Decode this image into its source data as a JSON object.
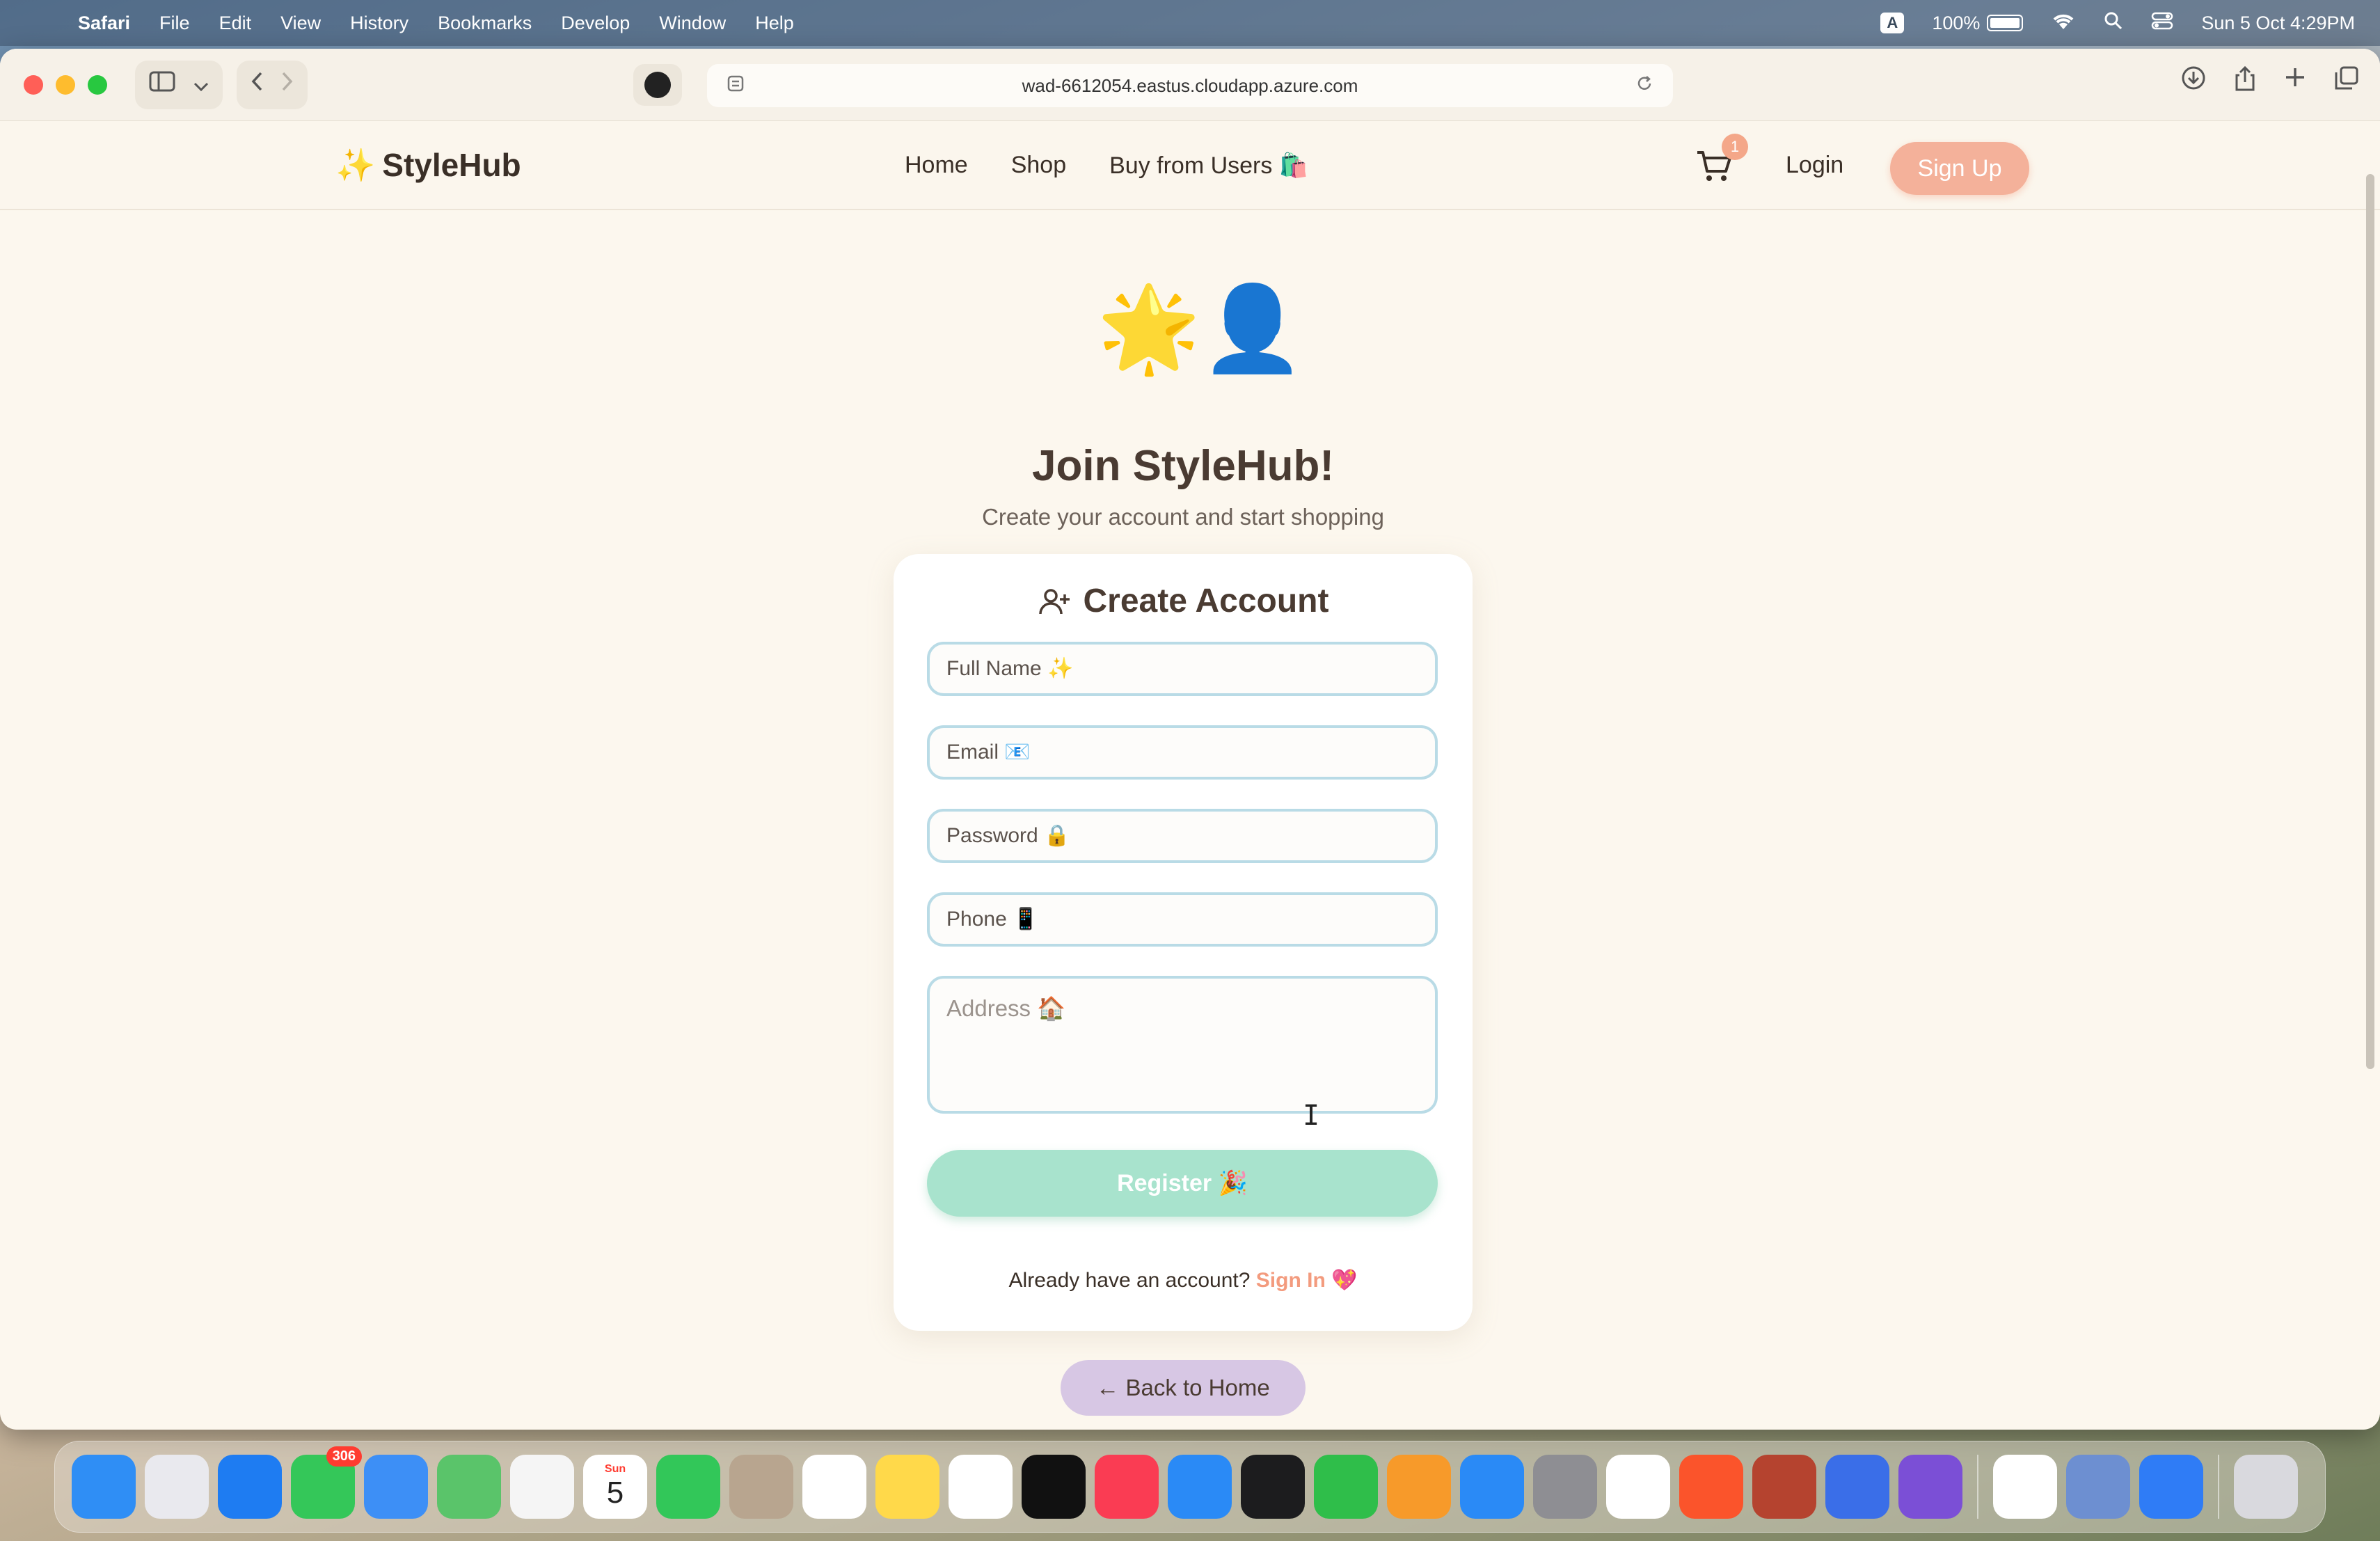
{
  "menubar": {
    "apple": "",
    "items": [
      "Safari",
      "File",
      "Edit",
      "View",
      "History",
      "Bookmarks",
      "Develop",
      "Window",
      "Help"
    ],
    "input_source": "A",
    "battery": "100%",
    "datetime": "Sun 5 Oct  4:29PM"
  },
  "browser": {
    "url": "wad-6612054.eastus.cloudapp.azure.com"
  },
  "site": {
    "logo_sparkle": "✨",
    "logo_text": "StyleHub",
    "nav": [
      "Home",
      "Shop",
      "Buy from Users 🛍️"
    ],
    "cart_count": "1",
    "login": "Login",
    "signup": "Sign Up"
  },
  "hero": {
    "emoji": "🌟👤",
    "title": "Join StyleHub!",
    "subtitle": "Create your account and start shopping"
  },
  "form": {
    "title": "Create Account",
    "full_name_placeholder": "Full Name ✨",
    "email_placeholder": "Email 📧",
    "password_placeholder": "Password 🔒",
    "phone_placeholder": "Phone 📱",
    "address_placeholder": "Address 🏠",
    "register_label": "Register 🎉",
    "signin_prompt": "Already have an account?",
    "signin_link": "Sign In 💖"
  },
  "back_home": "← Back to Home",
  "dock": {
    "messages_badge": "306",
    "calendar_day": "5",
    "calendar_month": "Sun",
    "apps": [
      {
        "name": "finder-icon",
        "color": "#2f8ef5"
      },
      {
        "name": "launchpad-icon",
        "color": "#e9e9ee"
      },
      {
        "name": "safari-icon",
        "color": "#1e7cf2"
      },
      {
        "name": "messages-icon",
        "color": "#34c759"
      },
      {
        "name": "mail-icon",
        "color": "#3d8ff6"
      },
      {
        "name": "maps-icon",
        "color": "#5ac46a"
      },
      {
        "name": "photos-icon",
        "color": "#f5f5f5"
      },
      {
        "name": "calendar-icon",
        "color": "#ffffff"
      },
      {
        "name": "facetime-icon",
        "color": "#32c759"
      },
      {
        "name": "contacts-icon",
        "color": "#b8a58f"
      },
      {
        "name": "reminders-icon",
        "color": "#ffffff"
      },
      {
        "name": "notes-icon",
        "color": "#ffd94a"
      },
      {
        "name": "freeform-icon",
        "color": "#ffffff"
      },
      {
        "name": "tv-icon",
        "color": "#111111"
      },
      {
        "name": "music-icon",
        "color": "#fa3c53"
      },
      {
        "name": "keynote-icon",
        "color": "#2a8af6"
      },
      {
        "name": "terminal-icon",
        "color": "#1c1c1e"
      },
      {
        "name": "numbers-icon",
        "color": "#2fbe4a"
      },
      {
        "name": "pages-icon",
        "color": "#f79a2a"
      },
      {
        "name": "app-store-icon",
        "color": "#2a8af6"
      },
      {
        "name": "system-settings-icon",
        "color": "#8e8e93"
      },
      {
        "name": "chrome-icon",
        "color": "#ffffff"
      },
      {
        "name": "brave-icon",
        "color": "#fb542b"
      },
      {
        "name": "dictionary-icon",
        "color": "#b5432f"
      },
      {
        "name": "simulator-icon",
        "color": "#3a6ee8"
      },
      {
        "name": "feedback-icon",
        "color": "#7b4fd6"
      }
    ],
    "apps_right": [
      {
        "name": "vscode-icon",
        "color": "#ffffff"
      },
      {
        "name": "disk-utility-icon",
        "color": "#6d8fd1"
      },
      {
        "name": "messenger-icon",
        "color": "#2f7cf6"
      }
    ]
  }
}
